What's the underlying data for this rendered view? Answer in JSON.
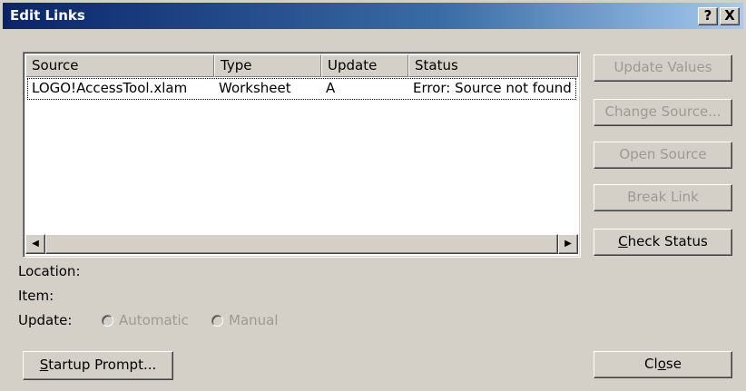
{
  "window": {
    "title": "Edit Links",
    "help_button": "?",
    "close_button": "X"
  },
  "links_list": {
    "columns": [
      "Source",
      "Type",
      "Update",
      "Status"
    ],
    "rows": [
      {
        "source": "LOGO!AccessTool.xlam",
        "type": "Worksheet",
        "update": "A",
        "status": "Error: Source not found"
      }
    ]
  },
  "buttons": {
    "update_values": "Update Values",
    "change_source": "Change Source...",
    "open_source": "Open Source",
    "break_link": "Break Link",
    "check_status_prefix": "C",
    "check_status_rest": "heck Status",
    "startup_prompt_prefix": "S",
    "startup_prompt_rest": "tartup Prompt...",
    "close_prefix": "Cl",
    "close_mnemonic": "o",
    "close_rest": "se"
  },
  "details": {
    "location_label": "Location:",
    "item_label": "Item:",
    "update_label": "Update:",
    "automatic_label": "Automatic",
    "manual_label": "Manual"
  },
  "colors": {
    "titlebar_start": "#0a246a",
    "titlebar_end": "#a6caf0",
    "dialog_bg": "#d4d0c8",
    "disabled_text": "#9c9a94"
  }
}
